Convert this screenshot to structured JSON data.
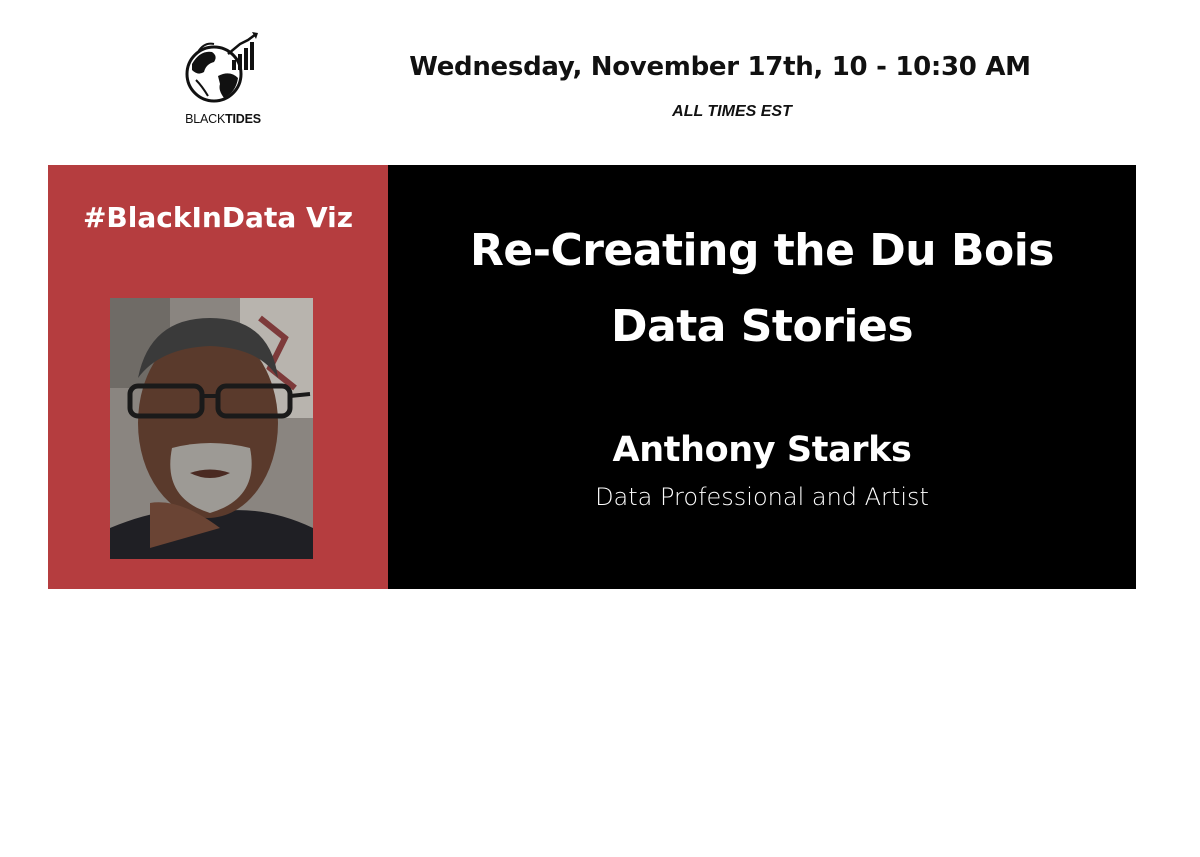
{
  "header": {
    "logo_text_light": "BLACK",
    "logo_text_bold": "TIDES",
    "event_date": "Wednesday, November 17th, 10 - 10:30 AM",
    "time_zone": "ALL TIMES EST"
  },
  "banner": {
    "hashtag": "#BlackInData Viz",
    "title": "Re-Creating the Du Bois Data Stories",
    "speaker_name": "Anthony Starks",
    "speaker_role": "Data Professional and Artist",
    "photo_icon": "speaker-photo"
  },
  "colors": {
    "accent_red": "#b53d3f",
    "panel_black": "#000000",
    "text_white": "#ffffff",
    "text_dark": "#111111"
  }
}
